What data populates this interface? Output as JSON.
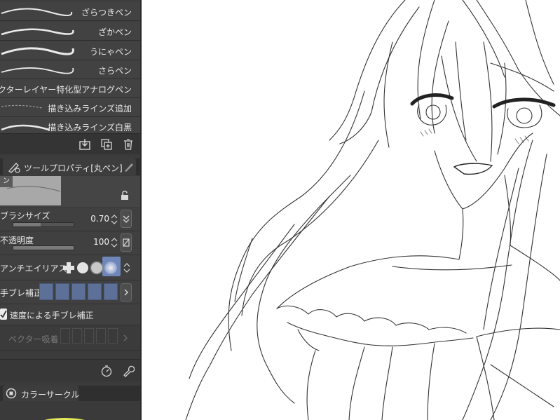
{
  "brush_list": {
    "items": [
      {
        "label": "ざらつきペン"
      },
      {
        "label": "ざかペン"
      },
      {
        "label": "うにゃペン"
      },
      {
        "label": "さらペン"
      },
      {
        "label": "ベクターレイヤー特化型アナログペン"
      },
      {
        "label": "描き込みラインズ追加"
      },
      {
        "label": "描き込みラインズ白黒"
      }
    ],
    "footer_icons": [
      "import-icon",
      "duplicate-icon",
      "trash-icon"
    ]
  },
  "tool_property": {
    "title": "ツールプロパティ[丸ペン]",
    "preview_name": "ン",
    "brush_size": {
      "label": "ブラシサイズ",
      "value": "0.70",
      "fill": 0.45
    },
    "opacity": {
      "label": "不透明度",
      "value": "100",
      "fill": 1.0
    },
    "antialias": {
      "label": "アンチエイリアス",
      "selected": 3
    },
    "stabilization": {
      "label": "手ブレ補正",
      "level": 5
    },
    "speed_stabilization": {
      "label": "速度による手ブレ補正",
      "checked": true
    },
    "vector_snap": {
      "label": "ベクター吸着"
    }
  },
  "color_circle": {
    "title": "カラーサークル"
  },
  "colors": {
    "panel": "#3b3b3b",
    "accent": "#6f86b8",
    "canvas": "#ffffff"
  }
}
